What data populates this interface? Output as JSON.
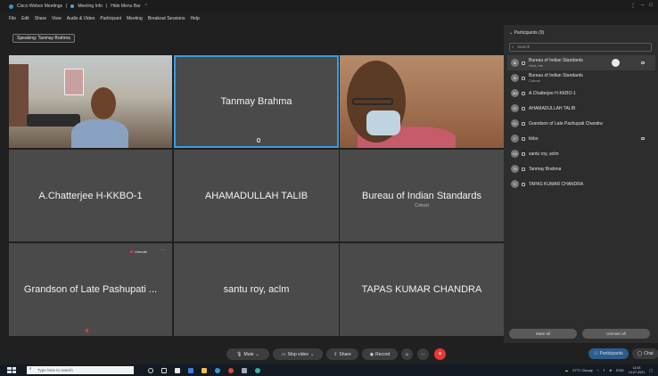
{
  "titlebar": {
    "app_title": "Cisco Webex Meetings",
    "tab_meeting_info": "Meeting Info",
    "tab_hide_menu": "Hide Menu Bar"
  },
  "menu": [
    "File",
    "Edit",
    "Share",
    "View",
    "Audio & Video",
    "Participant",
    "Meeting",
    "Breakout Sessions",
    "Help"
  ],
  "speaking": "Speaking: Tanmay Brahma",
  "tiles": {
    "t2_name": "Tanmay Brahma",
    "t4_name": "A.Chatterjee H-KKBO-1",
    "t5_name": "AHAMADULLAH TALIB",
    "t6_name": "Bureau of Indian Standards",
    "t6_sub": "Cohost",
    "t7_name": "Grandson of Late Pashupati ...",
    "t7_unmute": "Unmute",
    "t8_name": "santu roy, aclm",
    "t9_name": "TAPAS KUMAR CHANDRA"
  },
  "participants": {
    "title": "Participants (9)",
    "search_placeholder": "Search",
    "rows": [
      {
        "initials": "BI",
        "name": "Bureau of Indian Standards",
        "sub": "Host, me"
      },
      {
        "initials": "BI",
        "name": "Bureau of Indian Standards",
        "sub": "Cohost"
      },
      {
        "initials": "AH",
        "name": "A.Chatterjee H-KKBO-1",
        "sub": ""
      },
      {
        "initials": "AT",
        "name": "AHAMADULLAH TALIB",
        "sub": ""
      },
      {
        "initials": "GL",
        "name": "Grandson of Late Pashupati Chandra",
        "sub": ""
      },
      {
        "initials": "K",
        "name": "kkbo",
        "sub": ""
      },
      {
        "initials": "SA",
        "name": "santu roy, aclm",
        "sub": ""
      },
      {
        "initials": "TB",
        "name": "Tanmay Brahma",
        "sub": ""
      },
      {
        "initials": "TC",
        "name": "TAPAS KUMAR CHANDRA",
        "sub": ""
      }
    ],
    "mute_all": "Mute all",
    "unmute_all": "Unmute all"
  },
  "controls": {
    "mute": "Mute",
    "stop_video": "Stop video",
    "share": "Share",
    "record": "Record",
    "participants_tab": "Participants",
    "chat_tab": "Chat"
  },
  "taskbar": {
    "search_placeholder": "Type here to search",
    "weather": "27°C Cloudy",
    "lang": "ENG",
    "time": "11:03",
    "date": "14-07-2021"
  },
  "colors": {
    "accent": "#3b9be0",
    "end_call": "#e53935",
    "tile": "#4a4a4a",
    "panel": "#2d2d2d"
  }
}
